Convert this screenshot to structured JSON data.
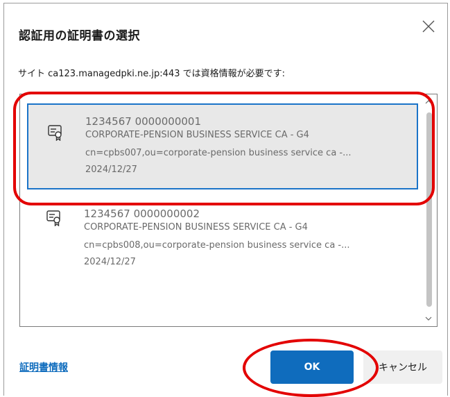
{
  "dialog": {
    "title": "認証用の証明書の選択",
    "subtitle": "サイト ca123.managedpki.ne.jp:443 では資格情報が必要です:",
    "close_icon": "close-icon"
  },
  "certificates": [
    {
      "name": "1234567 0000000001",
      "issuer": "CORPORATE-PENSION BUSINESS SERVICE CA - G4",
      "subject": "cn=cpbs007,ou=corporate-pension business service ca -...",
      "date": "2024/12/27",
      "selected": true,
      "icon": "certificate-icon"
    },
    {
      "name": "1234567 0000000002",
      "issuer": "CORPORATE-PENSION BUSINESS SERVICE CA - G4",
      "subject": "cn=cpbs008,ou=corporate-pension business service ca -...",
      "date": "2024/12/27",
      "selected": false,
      "icon": "certificate-icon"
    }
  ],
  "footer": {
    "info_link": "証明書情報",
    "ok_label": "OK",
    "cancel_label": "キャンセル"
  },
  "colors": {
    "accent": "#0f6cbd",
    "selection_border": "#1a73c8",
    "annotation": "#e30000"
  }
}
